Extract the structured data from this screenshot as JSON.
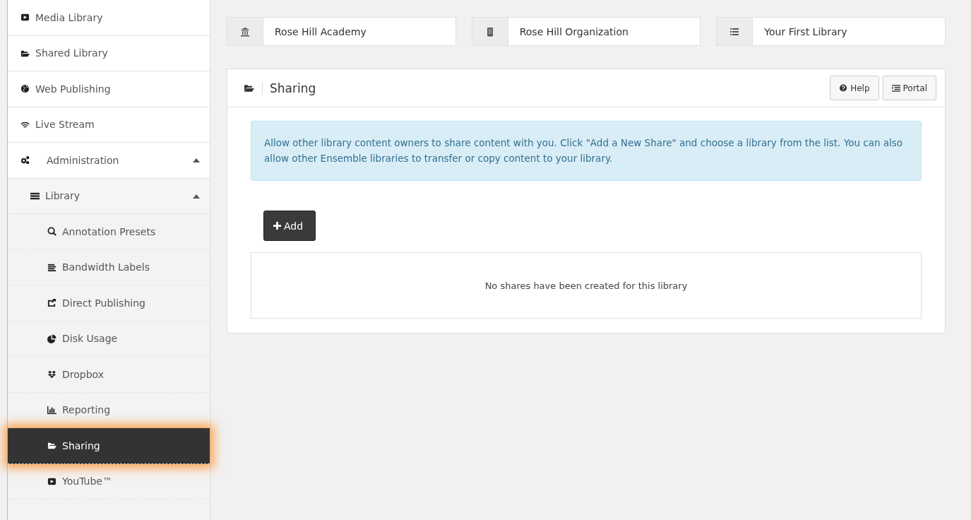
{
  "sidebar": {
    "items": [
      {
        "label": "Media Library",
        "selected": false
      },
      {
        "label": "Shared Library",
        "selected": false
      },
      {
        "label": "Web Publishing",
        "selected": false
      },
      {
        "label": "Live Stream",
        "selected": false
      },
      {
        "label": "Administration",
        "selected": false,
        "expanded": true,
        "children": [
          {
            "label": "Library",
            "selected": false,
            "expanded": true,
            "children": [
              {
                "label": "Annotation Presets",
                "selected": false
              },
              {
                "label": "Bandwidth Labels",
                "selected": false
              },
              {
                "label": "Direct Publishing",
                "selected": false
              },
              {
                "label": "Disk Usage",
                "selected": false
              },
              {
                "label": "Dropbox",
                "selected": false
              },
              {
                "label": "Reporting",
                "selected": false
              },
              {
                "label": "Sharing",
                "selected": true
              },
              {
                "label": "YouTube™",
                "selected": false
              }
            ]
          }
        ]
      }
    ]
  },
  "context_bar": [
    {
      "value": "Rose Hill Academy"
    },
    {
      "value": "Rose Hill Organization"
    },
    {
      "value": "Your First Library"
    }
  ],
  "panel": {
    "title": "Sharing",
    "buttons": [
      "Help",
      "Portal"
    ],
    "info": "Allow other library content owners to share content with you. Click \"Add a New Share\" and choose a library from the list. You can also allow other Ensemble libraries to transfer or copy content to your library.",
    "add_button": "Add",
    "empty_message": "No shares have been created for this library"
  }
}
